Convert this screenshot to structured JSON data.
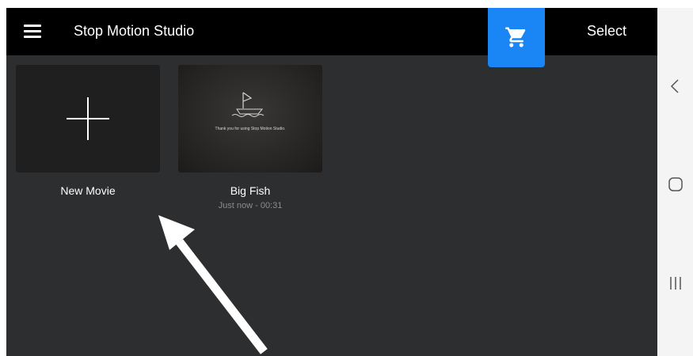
{
  "header": {
    "app_title": "Stop Motion Studio",
    "select_label": "Select",
    "menu_icon": "hamburger-menu-icon",
    "cart_icon": "shopping-cart-icon"
  },
  "tiles": [
    {
      "label": "New Movie",
      "icon": "plus-icon"
    },
    {
      "label": "Big Fish",
      "subtitle": "Just now - 00:31",
      "thumbnail_text": "Thank you for using Stop Motion Studio."
    }
  ],
  "system_nav": {
    "icons": [
      "back-icon",
      "home-icon",
      "recents-icon"
    ]
  },
  "colors": {
    "background": "#2d2e2f",
    "topbar": "#000000",
    "accent": "#1a86f5",
    "navbar": "#f4f4f4"
  }
}
